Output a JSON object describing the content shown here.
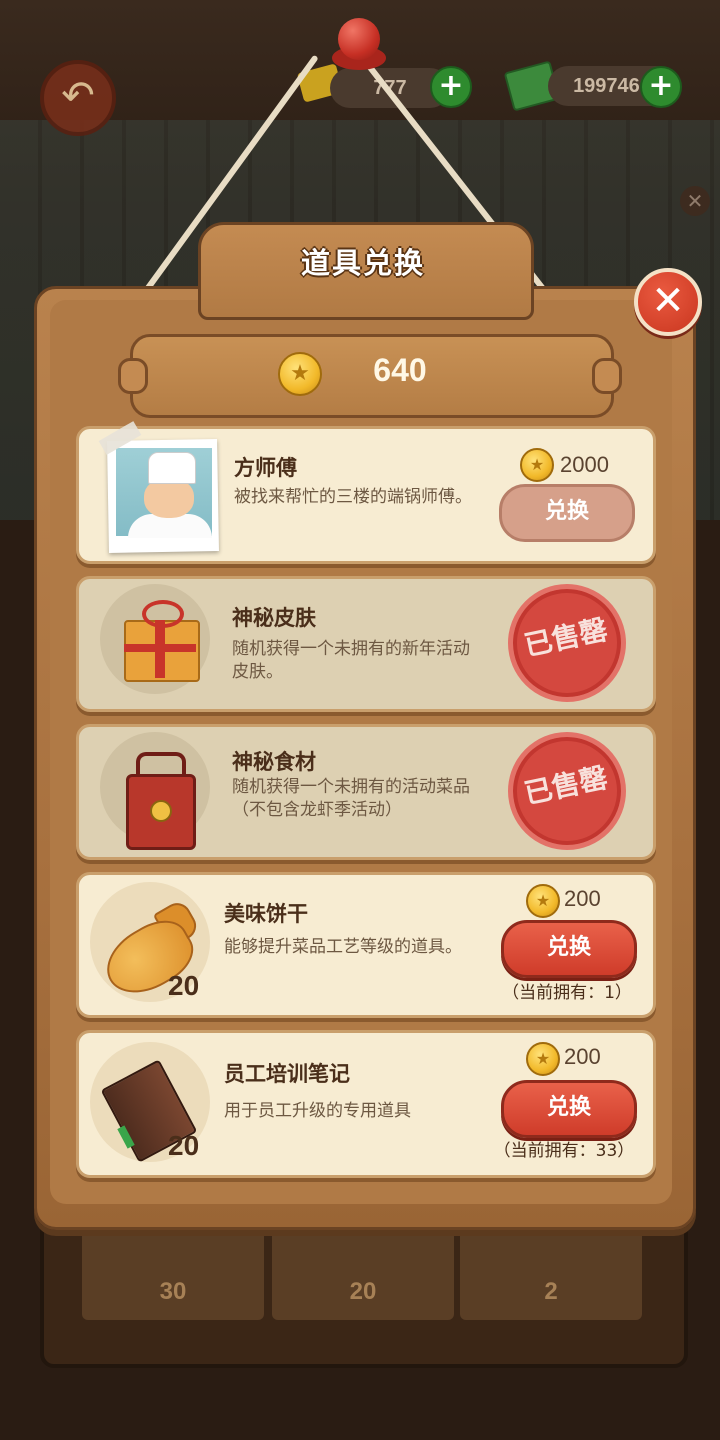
{
  "top_bar": {
    "back_icon": "back-arrow-icon",
    "gold_value": "777",
    "cash_value": "1997460",
    "plus_label": "+"
  },
  "background_slots": [
    {
      "count": "30"
    },
    {
      "count": "20"
    },
    {
      "count": "2"
    }
  ],
  "dialog": {
    "title": "道具兑换",
    "close_label": "✕",
    "coin_balance": "640"
  },
  "items": [
    {
      "name": "方师傅",
      "description": "被找来帮忙的三楼的端锅师傅。",
      "price": "2000",
      "button_label": "兑换"
    },
    {
      "name": "神秘皮肤",
      "description": "随机获得一个未拥有的新年活动皮肤。",
      "stamp_text": "已售罄"
    },
    {
      "name": "神秘食材",
      "description": "随机获得一个未拥有的活动菜品（不包含龙虾季活动）",
      "stamp_text": "已售罄"
    },
    {
      "name": "美味饼干",
      "description": "能够提升菜品工艺等级的道具。",
      "quantity": "20",
      "price": "200",
      "button_label": "兑换",
      "owned_text": "（当前拥有：1）"
    },
    {
      "name": "员工培训笔记",
      "description": "用于员工升级的专用道具",
      "quantity": "20",
      "price": "200",
      "button_label": "兑换",
      "owned_text": "（当前拥有：33）"
    }
  ],
  "colors": {
    "board_wood": "#b07a46",
    "card_bg": "#f7ecd2",
    "button_red": "#cf3c2a",
    "stamp_red": "#d43d36",
    "coin_gold": "#f2b92a"
  }
}
